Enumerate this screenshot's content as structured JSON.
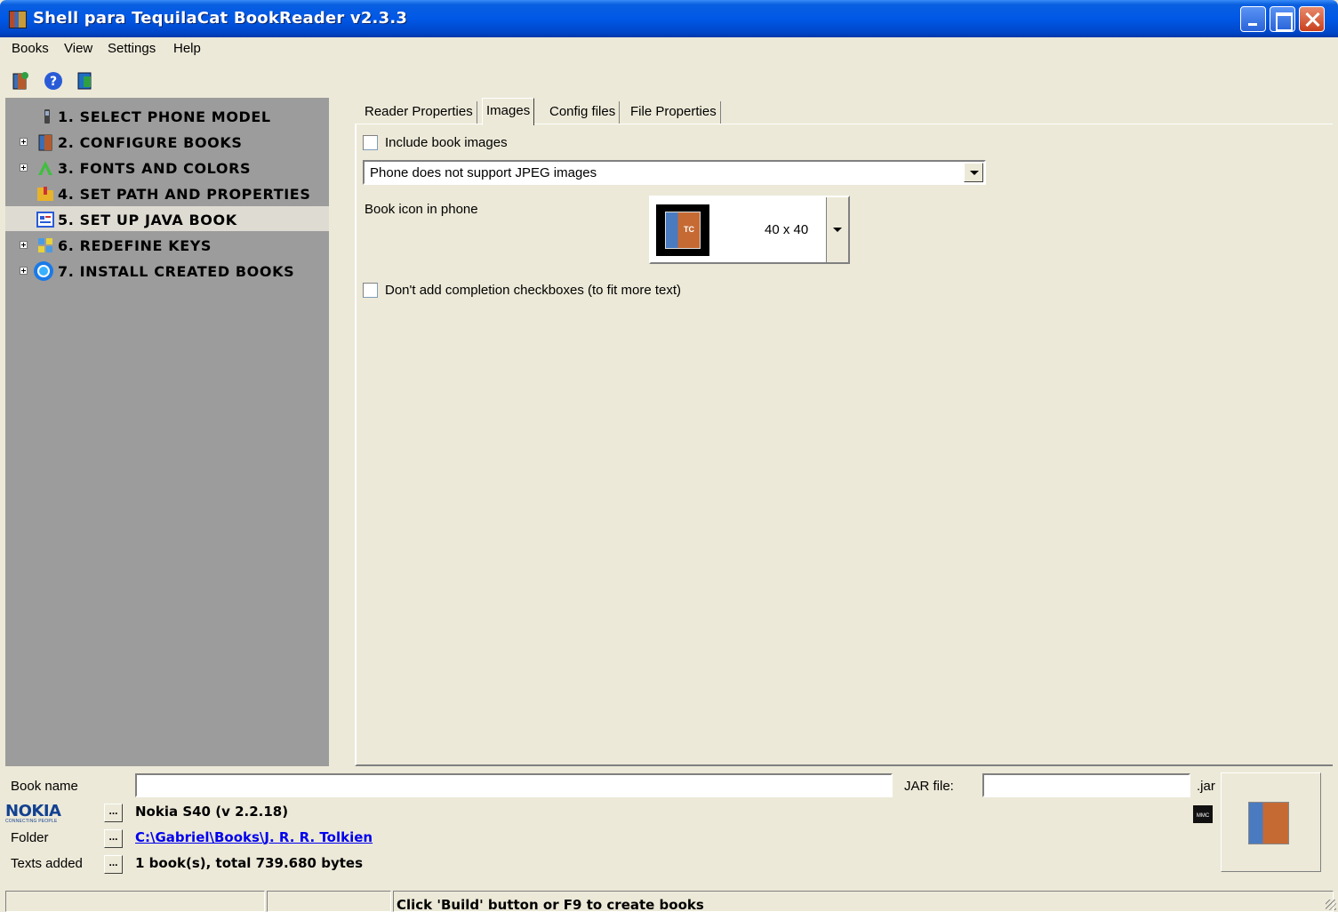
{
  "window": {
    "title": "Shell para TequilaCat BookReader v2.3.3"
  },
  "menu": [
    "Books",
    "View",
    "Settings",
    "Help"
  ],
  "toolbar": {
    "icons": [
      "new-book-icon",
      "help-icon",
      "exit-icon"
    ]
  },
  "tree": {
    "items": [
      {
        "label": "1. SELECT PHONE MODEL",
        "expandable": false,
        "icon": "phone-icon"
      },
      {
        "label": "2. CONFIGURE BOOKS",
        "expandable": true,
        "icon": "book-icon"
      },
      {
        "label": "3. FONTS AND COLORS",
        "expandable": true,
        "icon": "font-icon"
      },
      {
        "label": "4. SET PATH AND PROPERTIES",
        "expandable": false,
        "icon": "folder-icon"
      },
      {
        "label": "5. SET UP JAVA BOOK",
        "expandable": false,
        "icon": "java-icon",
        "selected": true
      },
      {
        "label": "6. REDEFINE KEYS",
        "expandable": true,
        "icon": "keys-icon"
      },
      {
        "label": "7. INSTALL CREATED BOOKS",
        "expandable": true,
        "icon": "globe-icon"
      }
    ]
  },
  "tabs": [
    {
      "label": "Reader Properties",
      "active": false
    },
    {
      "label": "Images",
      "active": true
    },
    {
      "label": "Config files",
      "active": false
    },
    {
      "label": "File Properties",
      "active": false
    }
  ],
  "images_tab": {
    "include_images_label": "Include book images",
    "include_images_checked": false,
    "jpeg_select_value": "Phone does not support JPEG images",
    "book_icon_label": "Book icon in phone",
    "book_icon_size": "40 x 40",
    "no_checkboxes_label": "Don't add completion checkboxes (to fit more text)",
    "no_checkboxes_checked": false
  },
  "bottom": {
    "book_name_label": "Book name",
    "book_name_value": "",
    "jar_label": "JAR file:",
    "jar_value": "",
    "jar_suffix": ".jar",
    "nokia_logo": "NOKIA",
    "nokia_tagline": "CONNECTING PEOPLE",
    "phone_value": "Nokia S40 (v 2.2.18)",
    "folder_label": "Folder",
    "folder_value": "C:\\Gabriel\\Books\\J. R. R. Tolkien",
    "texts_label": "Texts added",
    "texts_value": "1 book(s), total 739.680 bytes",
    "dots": "...",
    "mmc_label": "MMC"
  },
  "status": {
    "text": "Click 'Build' button or F9 to create books"
  }
}
